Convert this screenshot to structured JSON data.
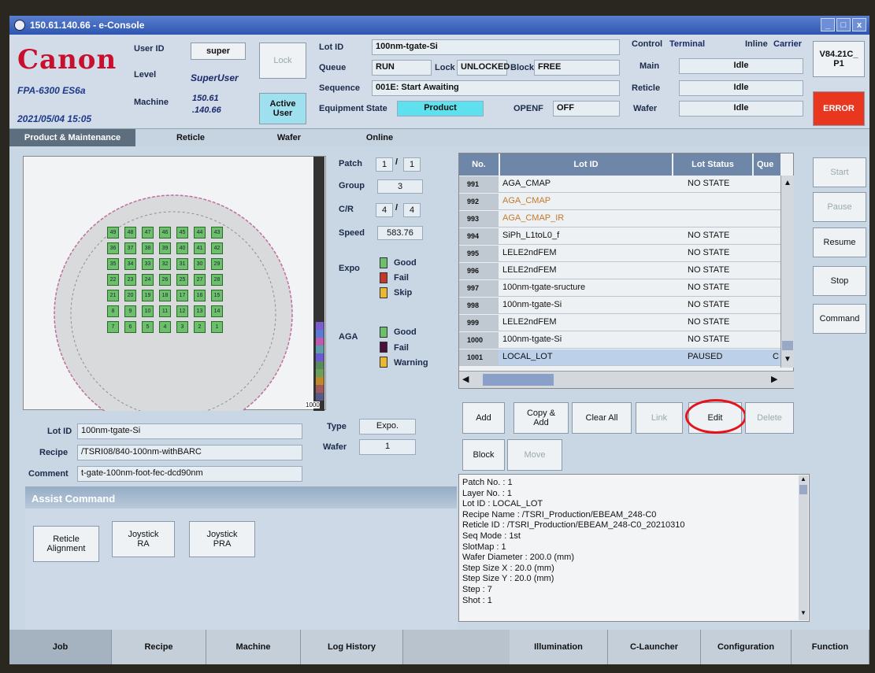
{
  "window": {
    "title": "150.61.140.66 - e-Console",
    "controls": [
      "_",
      "□",
      "x"
    ]
  },
  "header": {
    "brand": "Canon",
    "model": "FPA-6300 ES6a",
    "datetime": "2021/05/04 15:05",
    "user_id_label": "User ID",
    "user_id": "super",
    "level_label": "Level",
    "level": "SuperUser",
    "machine_label": "Machine",
    "machine_1": "150.61",
    "machine_2": ".140.66",
    "lock_button": "Lock",
    "active_user_1": "Active",
    "active_user_2": "User",
    "lot_id_label": "Lot ID",
    "lot_id": "100nm-tgate-Si",
    "queue_label": "Queue",
    "queue": "RUN",
    "lock_label": "Lock",
    "lock_state": "UNLOCKED",
    "block_label": "Block",
    "block_state": "FREE",
    "sequence_label": "Sequence",
    "sequence": "001E: Start Awaiting",
    "equipment_state_label": "Equipment State",
    "equipment_state": "Product",
    "openf_label": "OPENF",
    "openf": "OFF",
    "control_label": "Control",
    "control": "Terminal",
    "inline_label": "Inline",
    "inline": "Carrier",
    "main_label": "Main",
    "main": "Idle",
    "reticle_label": "Reticle",
    "reticle": "Idle",
    "wafer_label": "Wafer",
    "wafer": "Idle",
    "version_1": "V84.21C_",
    "version_2": "P1",
    "error_button": "ERROR"
  },
  "tabs": [
    "Product & Maintenance",
    "Reticle",
    "Wafer",
    "Online"
  ],
  "wafer_info": {
    "patch_label": "Patch",
    "patch_a": "1",
    "patch_b": "1",
    "group_label": "Group",
    "group": "3",
    "cr_label": "C/R",
    "cr_a": "4",
    "cr_b": "4",
    "speed_label": "Speed",
    "speed": "583.76",
    "expo_label": "Expo",
    "expo_good": "Good",
    "expo_fail": "Fail",
    "expo_skip": "Skip",
    "aga_label": "AGA",
    "aga_good": "Good",
    "aga_fail": "Fail",
    "aga_warning": "Warning",
    "type_label": "Type",
    "type": "Expo.",
    "wafer_label": "Wafer",
    "wafer": "1",
    "scale_max": "1000",
    "colors": {
      "good": "#6cc06a",
      "fail": "#c0392b",
      "skip": "#e9b730",
      "aga_fail": "#4a0f3a"
    }
  },
  "dies": [
    [
      "49",
      "48",
      "47",
      "46",
      "45",
      "44",
      "43"
    ],
    [
      "36",
      "37",
      "38",
      "39",
      "40",
      "41",
      "42"
    ],
    [
      "35",
      "34",
      "33",
      "32",
      "31",
      "30",
      "29"
    ],
    [
      "22",
      "23",
      "24",
      "26",
      "25",
      "27",
      "28"
    ],
    [
      "21",
      "20",
      "19",
      "18",
      "17",
      "16",
      "15"
    ],
    [
      "8",
      "9",
      "10",
      "11",
      "12",
      "13",
      "14"
    ],
    [
      "7",
      "6",
      "5",
      "4",
      "3",
      "2",
      "1"
    ]
  ],
  "lot_info": {
    "lot_id_label": "Lot ID",
    "lot_id": "100nm-tgate-Si",
    "recipe_label": "Recipe",
    "recipe": "/TSRI08/840-100nm-withBARC",
    "comment_label": "Comment",
    "comment": "t-gate-100nm-foot-fec-dcd90nm"
  },
  "lot_table": {
    "headers": [
      "No.",
      "Lot ID",
      "Lot Status",
      "Que"
    ],
    "rows": [
      {
        "no": "991",
        "lot": "AGA_CMAP",
        "status": "NO STATE"
      },
      {
        "no": "992",
        "lot": "AGA_CMAP",
        "status": ""
      },
      {
        "no": "993",
        "lot": "AGA_CMAP_IR",
        "status": ""
      },
      {
        "no": "994",
        "lot": "SiPh_L1toL0_f",
        "status": "NO STATE"
      },
      {
        "no": "995",
        "lot": "LELE2ndFEM",
        "status": "NO STATE"
      },
      {
        "no": "996",
        "lot": "LELE2ndFEM",
        "status": "NO STATE"
      },
      {
        "no": "997",
        "lot": "100nm-tgate-sructure",
        "status": "NO STATE"
      },
      {
        "no": "998",
        "lot": "100nm-tgate-Si",
        "status": "NO STATE"
      },
      {
        "no": "999",
        "lot": "LELE2ndFEM",
        "status": "NO STATE"
      },
      {
        "no": "1000",
        "lot": "100nm-tgate-Si",
        "status": "NO STATE"
      },
      {
        "no": "1001",
        "lot": "LOCAL_LOT",
        "status": "PAUSED",
        "que": "C"
      }
    ]
  },
  "lot_actions": {
    "add": "Add",
    "copy_add_1": "Copy &",
    "copy_add_2": "Add",
    "clear_all": "Clear All",
    "link": "Link",
    "edit": "Edit",
    "delete": "Delete",
    "block": "Block",
    "move": "Move"
  },
  "details": "Patch No. : 1\nLayer No. : 1\nLot ID : LOCAL_LOT\nRecipe Name : /TSRI_Production/EBEAM_248-C0\nReticle ID : /TSRI_Production/EBEAM_248-C0_20210310\nSeq Mode : 1st\nSlotMap : 1\nWafer Diameter : 200.0 (mm)\nStep Size X : 20.0 (mm)\nStep Size Y : 20.0 (mm)\nStep : 7\nShot : 1",
  "assist": {
    "title": "Assist Command",
    "reticle_alignment_1": "Reticle",
    "reticle_alignment_2": "Alignment",
    "joystick_ra_1": "Joystick",
    "joystick_ra_2": "RA",
    "joystick_pra_1": "Joystick",
    "joystick_pra_2": "PRA"
  },
  "right_buttons": [
    "Start",
    "Pause",
    "Resume",
    "Stop",
    "Command"
  ],
  "bottom_tabs": [
    "Job",
    "Recipe",
    "Machine",
    "Log History",
    "Illumination",
    "C-Launcher",
    "Configuration",
    "Function"
  ]
}
